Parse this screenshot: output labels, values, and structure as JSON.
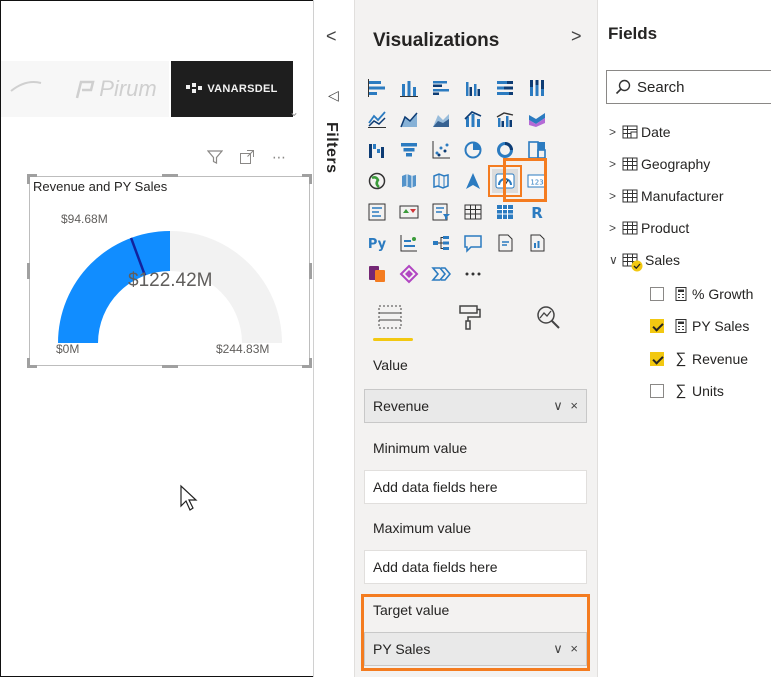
{
  "canvas": {
    "logos": {
      "pirum": "Pirum",
      "vanarsdel": "VANARSDEL"
    },
    "visual": {
      "title": "Revenue and PY Sales",
      "target_label": "$94.68M",
      "center_value": "$122.42M",
      "min_label": "$0M",
      "max_label": "$244.83M",
      "value_fraction": 0.5,
      "target_fraction": 0.387,
      "fill_color": "#118DFF",
      "track_color": "#F2F2F2",
      "target_color": "#12239E"
    }
  },
  "filters_pane": {
    "label": "Filters"
  },
  "visualizations_pane": {
    "title": "Visualizations",
    "selected_icon": "gauge-icon",
    "wells": [
      {
        "label": "Value",
        "value": "Revenue",
        "filled": true
      },
      {
        "label": "Minimum value",
        "value": "Add data fields here",
        "filled": false
      },
      {
        "label": "Maximum value",
        "value": "Add data fields here",
        "filled": false
      },
      {
        "label": "Target value",
        "value": "PY Sales",
        "filled": true
      }
    ],
    "well_actions": "∨ ×"
  },
  "fields_pane": {
    "title": "Fields",
    "search_placeholder": "Search",
    "tables": [
      "Date",
      "Geography",
      "Manufacturer",
      "Product",
      "Sales"
    ],
    "sales_fields": [
      {
        "label": "% Growth",
        "checked": false,
        "icon": "calculator-icon"
      },
      {
        "label": "PY Sales",
        "checked": true,
        "icon": "calculator-icon"
      },
      {
        "label": "Revenue",
        "checked": true,
        "icon": "sigma-icon"
      },
      {
        "label": "Units",
        "checked": false,
        "icon": "sigma-icon"
      }
    ]
  },
  "accent_colors": {
    "highlight": "#F47C20",
    "yellow": "#F2C811"
  }
}
